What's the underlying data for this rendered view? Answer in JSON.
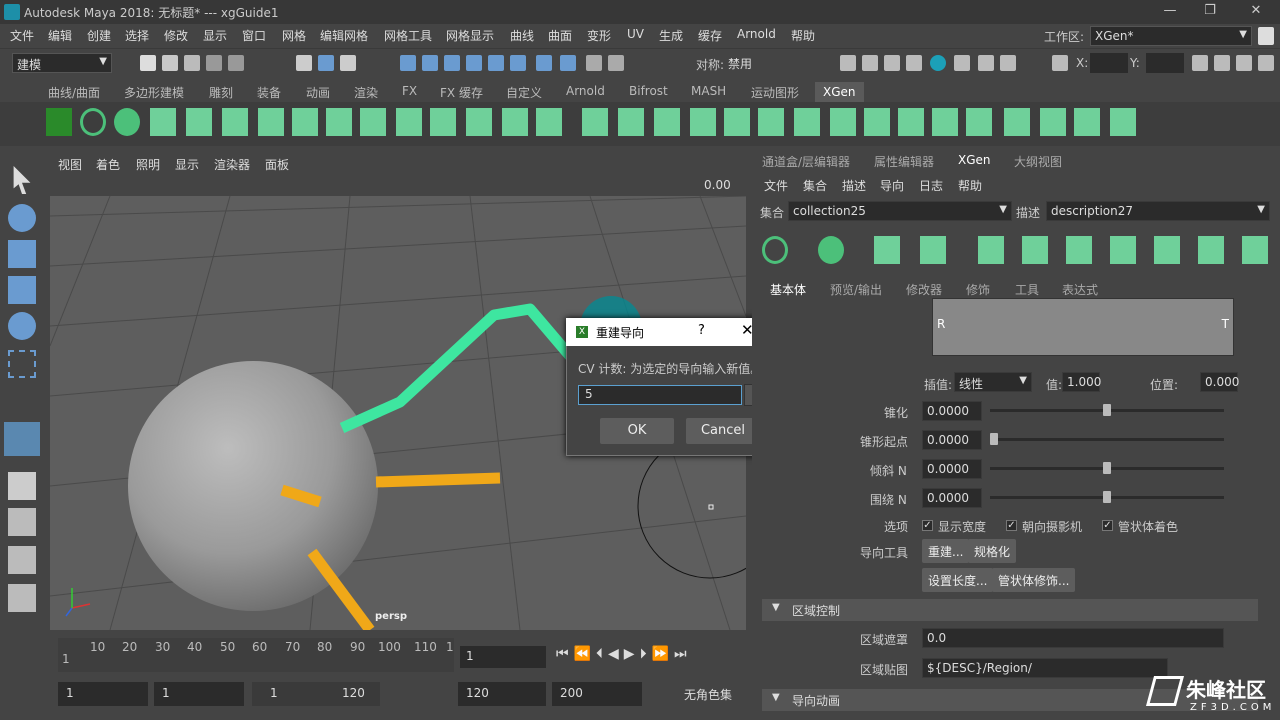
{
  "window": {
    "title": "Autodesk Maya 2018: 无标题*   ---   xgGuide1",
    "minimize": "—",
    "restore": "❐",
    "close": "✕"
  },
  "menubar": {
    "items": [
      "文件",
      "编辑",
      "创建",
      "选择",
      "修改",
      "显示",
      "窗口",
      "网格",
      "编辑网格",
      "网格工具",
      "网格显示",
      "曲线",
      "曲面",
      "变形",
      "UV",
      "生成",
      "缓存",
      "Arnold",
      "帮助"
    ],
    "workspace_label": "工作区:",
    "workspace_value": "XGen*"
  },
  "statusline": {
    "mode": "建模",
    "symmetry_label": "对称:",
    "symmetry_value": "禁用",
    "x_label": "X:",
    "y_label": "Y:"
  },
  "shelf": {
    "tabs": [
      "曲线/曲面",
      "多边形建模",
      "雕刻",
      "装备",
      "动画",
      "渲染",
      "FX",
      "FX 缓存",
      "自定义",
      "Arnold",
      "Bifrost",
      "MASH",
      "运动图形",
      "XGen"
    ],
    "active_tab": "XGen"
  },
  "viewport": {
    "menus": [
      "视图",
      "着色",
      "照明",
      "显示",
      "渲染器",
      "面板"
    ],
    "zoom_value": "0.00",
    "camera_label": "persp"
  },
  "timeline": {
    "ticks": [
      "1",
      "10",
      "20",
      "30",
      "40",
      "50",
      "60",
      "70",
      "80",
      "90",
      "100",
      "110",
      "1"
    ],
    "current_frame": "1",
    "range_start": "1",
    "range_inner_start": "1",
    "range_slider_start": "1",
    "range_slider_end": "120",
    "range_inner_end": "120",
    "range_end": "200",
    "character_set": "无角色集"
  },
  "right_panel": {
    "tabs": [
      "通道盒/层编辑器",
      "属性编辑器",
      "XGen",
      "大纲视图"
    ],
    "active_tab": "XGen",
    "menus": [
      "文件",
      "集合",
      "描述",
      "导向",
      "日志",
      "帮助"
    ],
    "collection_label": "集合",
    "collection_value": "collection25",
    "description_label": "描述",
    "description_value": "description27",
    "subtabs": [
      "基本体",
      "预览/输出",
      "修改器",
      "修饰",
      "工具",
      "表达式"
    ],
    "active_subtab": "基本体",
    "ramp_left": "R",
    "ramp_right": "T",
    "interp_label": "插值:",
    "interp_value": "线性",
    "value_label": "值:",
    "value_value": "1.000",
    "position_label": "位置:",
    "position_value": "0.000",
    "params": [
      {
        "label": "锥化",
        "value": "0.0000",
        "knob": 0.5
      },
      {
        "label": "锥形起点",
        "value": "0.0000",
        "knob": 0.0
      },
      {
        "label": "倾斜 N",
        "value": "0.0000",
        "knob": 0.5
      },
      {
        "label": "围绕 N",
        "value": "0.0000",
        "knob": 0.5
      }
    ],
    "options_label": "选项",
    "options": [
      "显示宽度",
      "朝向摄影机",
      "管状体着色"
    ],
    "guide_tools_label": "导向工具",
    "buttons": [
      "重建...",
      "规格化",
      "设置长度...",
      "管状体修饰..."
    ],
    "section_region": "区域控制",
    "region_mask_label": "区域遮罩",
    "region_mask_value": "0.0",
    "region_map_label": "区域贴图",
    "region_map_value": "${DESC}/Region/",
    "section_guide_anim": "导向动画"
  },
  "dialog": {
    "title": "重建导向",
    "help": "?",
    "close": "✕",
    "message": "CV 计数: 为选定的导向输入新值。",
    "input_value": "5",
    "ok": "OK",
    "cancel": "Cancel"
  },
  "watermark": {
    "text": "朱峰社区",
    "subtext": "ZF3D.COM"
  },
  "colors": {
    "guide_green": "#3ee6a0",
    "guide_orange": "#f0a818",
    "accent_blue": "#5ba0d0"
  }
}
